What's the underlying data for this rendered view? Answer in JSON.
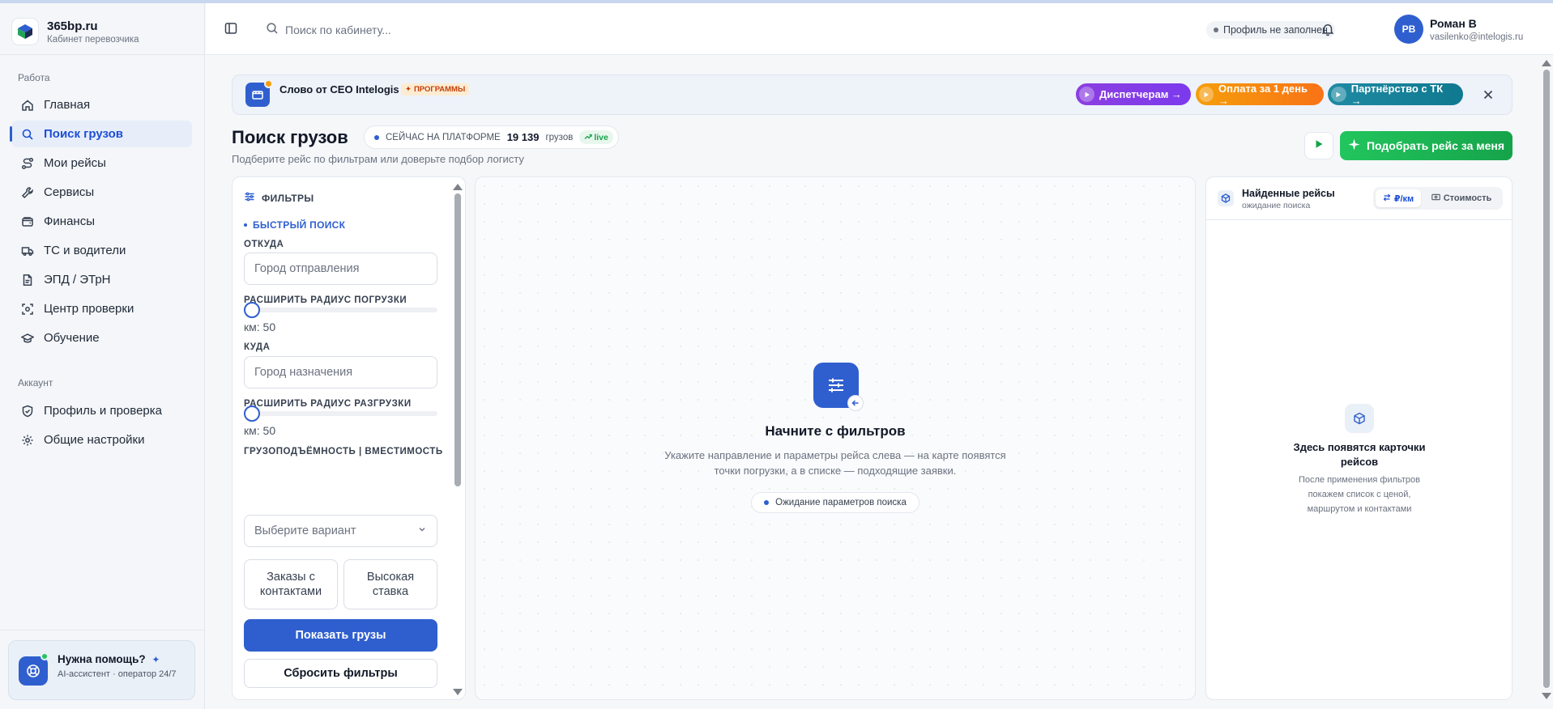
{
  "brand": {
    "name": "365bp.ru",
    "subtitle": "Кабинет перевозчика"
  },
  "sidebar": {
    "section_work": "Работа",
    "work_items": [
      {
        "label": "Главная",
        "icon": "home-icon"
      },
      {
        "label": "Поиск грузов",
        "icon": "search-icon",
        "active": true
      },
      {
        "label": "Мои рейсы",
        "icon": "route-icon"
      },
      {
        "label": "Сервисы",
        "icon": "wrench-icon"
      },
      {
        "label": "Финансы",
        "icon": "wallet-icon"
      },
      {
        "label": "ТС и водители",
        "icon": "truck-icon"
      },
      {
        "label": "ЭПД / ЭТрН",
        "icon": "document-icon"
      },
      {
        "label": "Центр проверки",
        "icon": "scan-icon"
      },
      {
        "label": "Обучение",
        "icon": "graduation-cap-icon"
      }
    ],
    "section_account": "Аккаунт",
    "account_items": [
      {
        "label": "Профиль и проверка",
        "icon": "shield-check-icon"
      },
      {
        "label": "Общие настройки",
        "icon": "gear-icon"
      }
    ],
    "help": {
      "title": "Нужна помощь?",
      "subtitle": "AI-ассистент · оператор 24/7",
      "icon": "lifebuoy-icon"
    }
  },
  "topbar": {
    "search_placeholder": "Поиск по кабинету...",
    "profile_status": "Профиль не заполнен",
    "user": {
      "initials": "РВ",
      "name": "Роман В",
      "email": "vasilenko@intelogis.ru"
    }
  },
  "banner": {
    "title": "Слово от CEO Intelogis",
    "tag": "ПРОГРАММЫ",
    "pills": [
      {
        "label": "Диспетчерам →",
        "color": "#7c3aed"
      },
      {
        "label": "Оплата за 1 день →",
        "color": "#f97316"
      },
      {
        "label": "Партнёрство с ТК →",
        "color": "#0f7990"
      }
    ]
  },
  "page": {
    "title": "Поиск грузов",
    "live_label": "СЕЙЧАС НА ПЛАТФОРМЕ",
    "live_count": "19 139",
    "live_unit": "грузов",
    "live_badge": "live",
    "subtitle": "Подберите рейс по фильтрам или доверьте подбор логисту",
    "match_button": "Подобрать рейс за меня"
  },
  "filters": {
    "header": "ФИЛЬТРЫ",
    "quick_search": "БЫСТРЫЙ ПОИСК",
    "from_label": "ОТКУДА",
    "from_placeholder": "Город отправления",
    "load_radius_label": "РАСШИРИТЬ РАДИУС ПОГРУЗКИ",
    "load_radius_value": "км: 50",
    "load_radius_km": 50,
    "to_label": "КУДА",
    "to_placeholder": "Город назначения",
    "unload_radius_label": "РАСШИРИТЬ РАДИУС РАЗГРУЗКИ",
    "unload_radius_value": "км: 50",
    "unload_radius_km": 50,
    "capacity_label": "ГРУЗОПОДЪЁМНОСТЬ | ВМЕСТИМОСТЬ",
    "capacity_placeholder": "Выберите вариант",
    "chip_contacts": "Заказы с контактами",
    "chip_high_rate": "Высокая ставка",
    "show_button": "Показать грузы",
    "reset_button": "Сбросить фильтры"
  },
  "center": {
    "title": "Начните с фильтров",
    "text": "Укажите направление и параметры рейса слева — на карте появятся точки погрузки, а в списке — подходящие заявки.",
    "status": "Ожидание параметров поиска"
  },
  "results": {
    "title": "Найденные рейсы",
    "subtitle": "ожидание поиска",
    "tab_per_km": "₽/км",
    "tab_cost": "Стоимость",
    "empty_title": "Здесь появятся карточки рейсов",
    "empty_text": "После применения фильтров покажем список с ценой, маршрутом и контактами"
  },
  "colors": {
    "accent": "#2f5fcf",
    "success": "#16a34a",
    "warning": "#f59e0b"
  }
}
